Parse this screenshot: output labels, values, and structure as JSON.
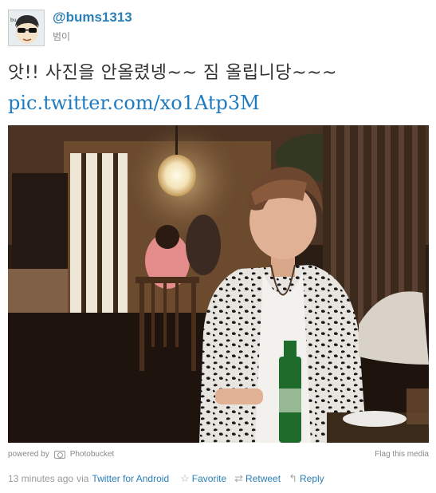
{
  "user": {
    "handle": "@bums1313",
    "name": "범이"
  },
  "tweet": {
    "text": "앗!! 사진을 안올렸넹~~ 짐 올립니당~~~",
    "link": "pic.twitter.com/xo1Atp3M"
  },
  "media": {
    "powered_by": "powered by",
    "provider": "Photobucket",
    "flag": "Flag this media"
  },
  "meta": {
    "timestamp": "13 minutes ago",
    "via": "via",
    "client": "Twitter for Android",
    "favorite": "Favorite",
    "retweet": "Retweet",
    "reply": "Reply"
  },
  "colors": {
    "link": "#2a7fb8",
    "muted": "#888888"
  },
  "icons": [
    "avatar-cartoon",
    "camera-icon",
    "star-icon",
    "retweet-icon",
    "reply-icon"
  ]
}
